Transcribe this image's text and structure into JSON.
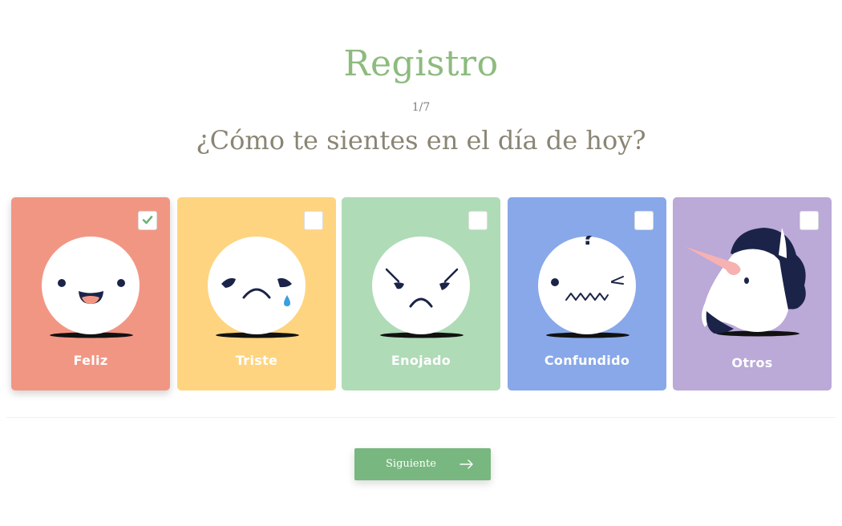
{
  "header": {
    "title": "Registro",
    "step": "1/7",
    "question": "¿Cómo te sientes en el día de hoy?"
  },
  "moods": [
    {
      "label": "Feliz",
      "color": "#f29684",
      "selected": true,
      "icon": "happy-face-icon"
    },
    {
      "label": "Triste",
      "color": "#fed480",
      "selected": false,
      "icon": "sad-face-icon"
    },
    {
      "label": "Enojado",
      "color": "#afdbb7",
      "selected": false,
      "icon": "angry-face-icon"
    },
    {
      "label": "Confundido",
      "color": "#88a8e9",
      "selected": false,
      "icon": "confused-face-icon"
    },
    {
      "label": "Otros",
      "color": "#bba9d8",
      "selected": false,
      "icon": "unicorn-icon"
    }
  ],
  "footer": {
    "next_label": "Siguiente",
    "next_color": "#78b77f"
  }
}
